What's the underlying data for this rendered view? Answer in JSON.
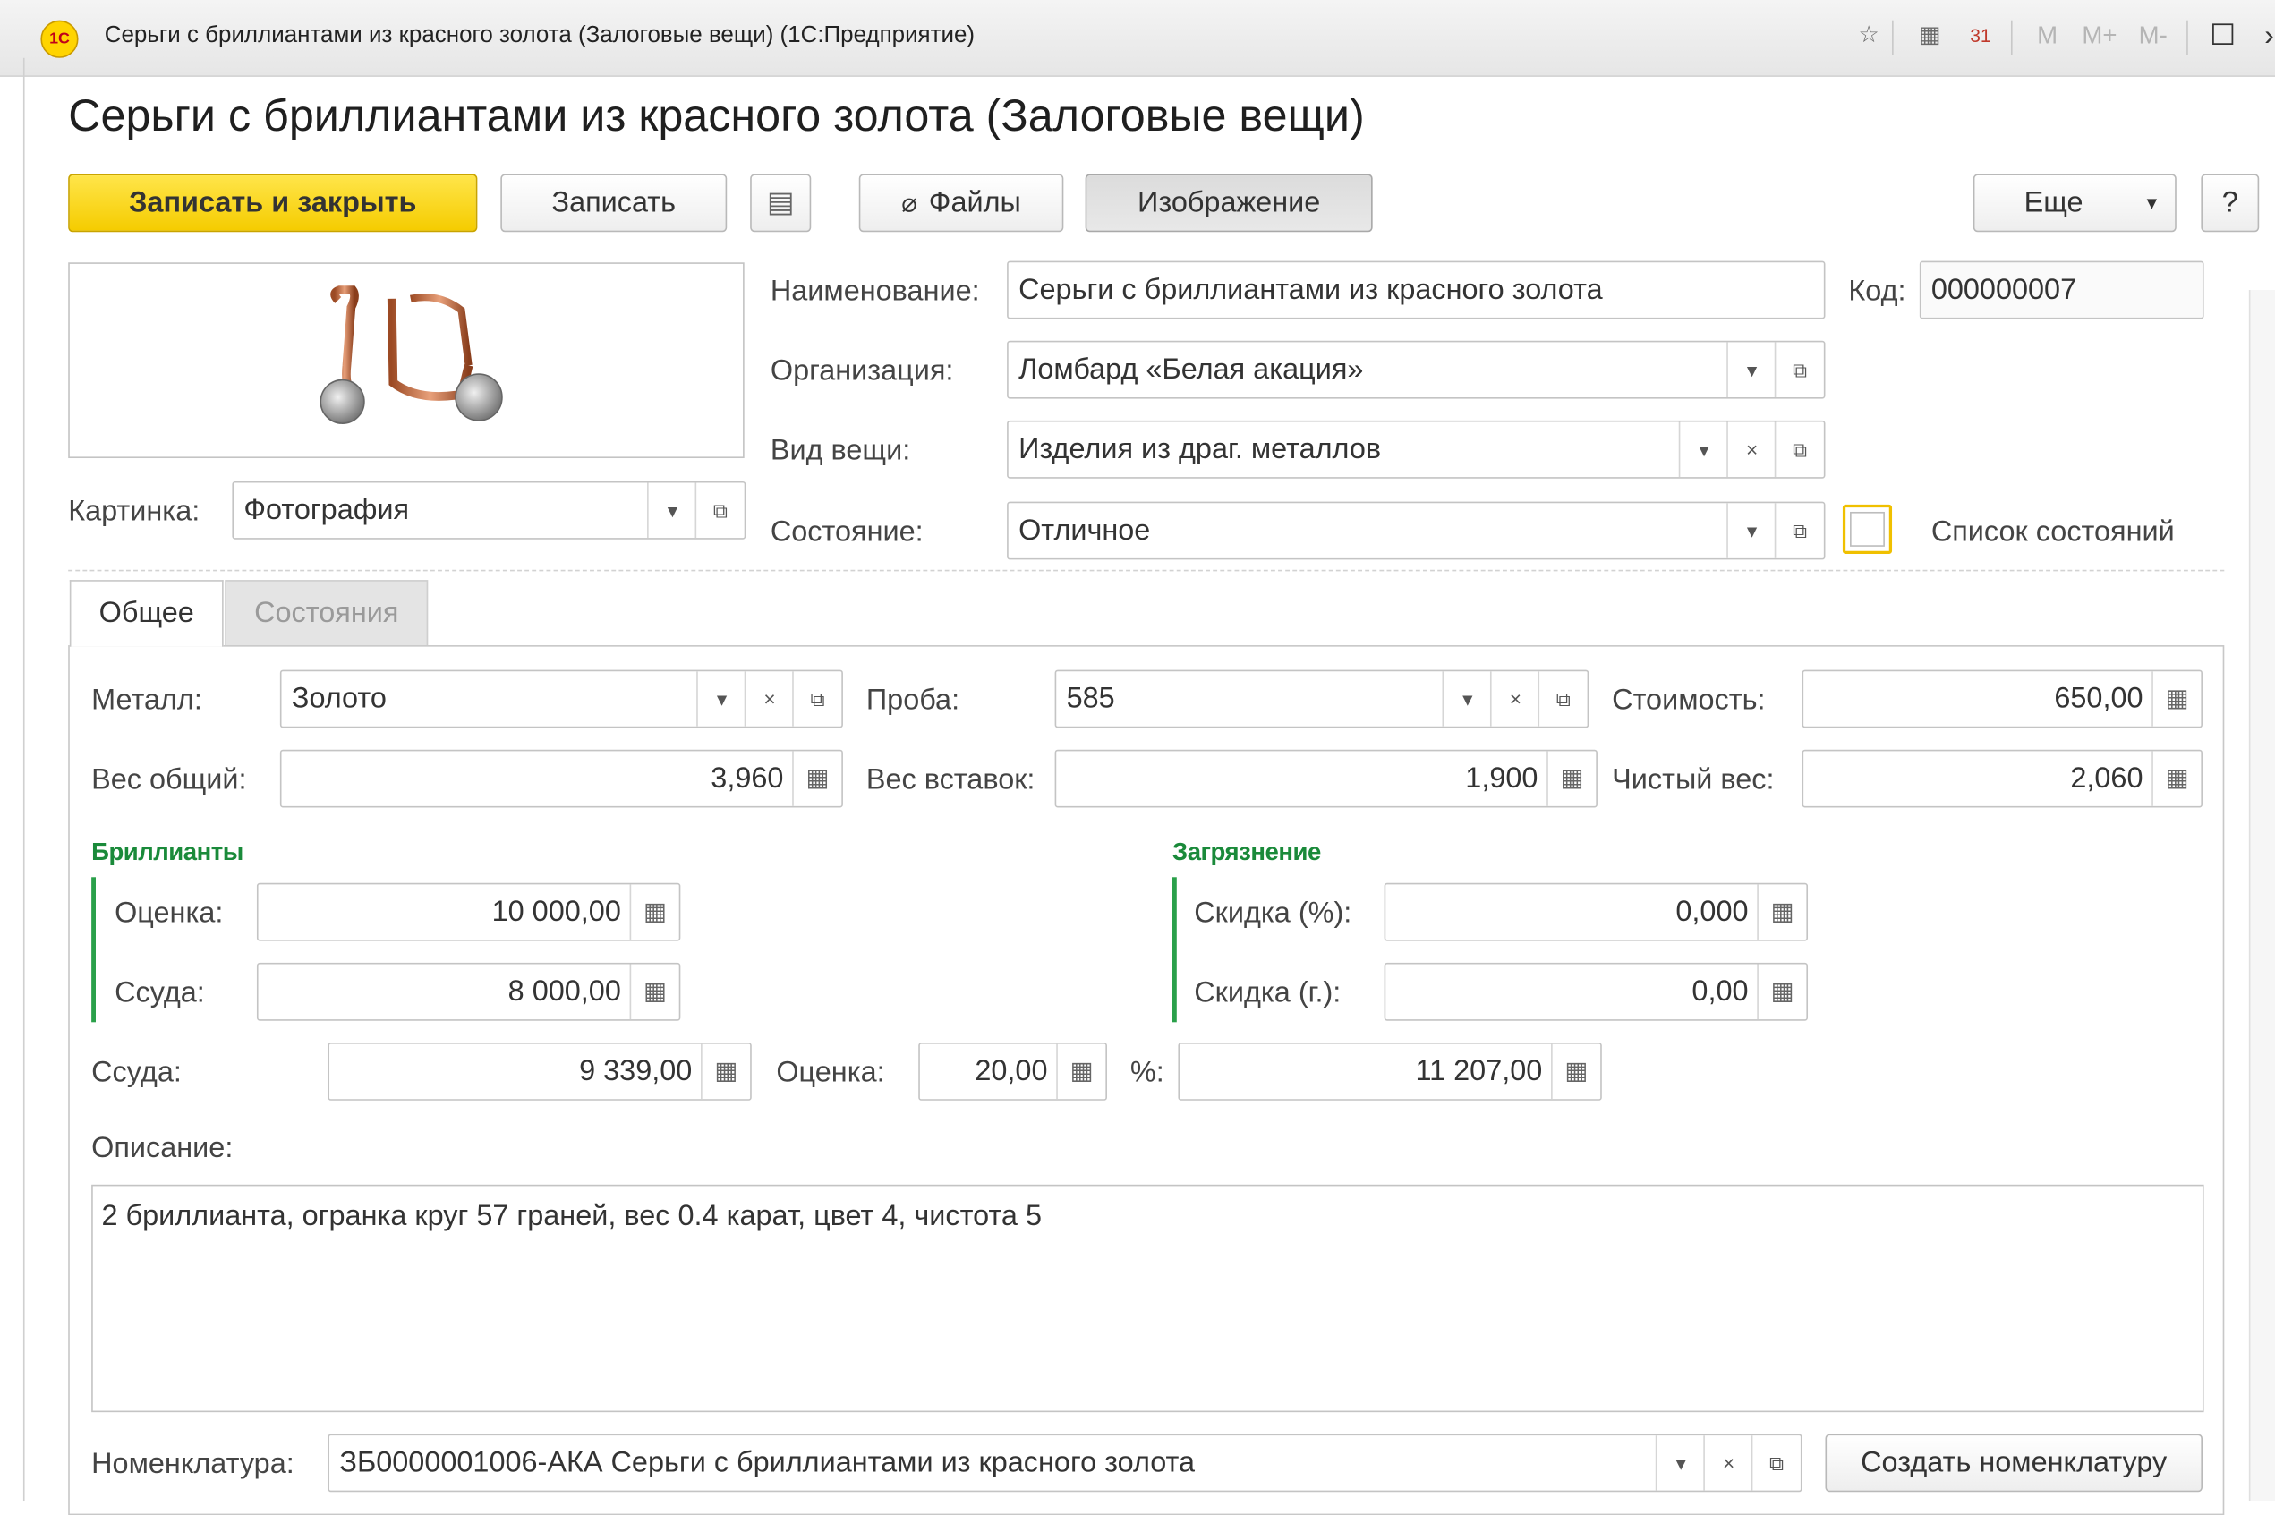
{
  "window": {
    "title": "Серьги с бриллиантами из красного золота (Залоговые вещи)  (1С:Предприятие)",
    "logo_text": "1С",
    "toolbar_icons": [
      "bookmark-star-icon",
      "calculator-icon",
      "calendar-icon"
    ],
    "calendar_day": "31",
    "memory_buttons": [
      "M",
      "M+",
      "M-"
    ],
    "maximize_glyph": "☐",
    "more_glyph": "›"
  },
  "page": {
    "title": "Серьги с бриллиантами из красного золота (Залоговые вещи)"
  },
  "toolbar": {
    "save_close": "Записать и закрыть",
    "save": "Записать",
    "files": "Файлы",
    "image": "Изображение",
    "more": "Еще",
    "help": "?"
  },
  "header": {
    "name_label": "Наименование:",
    "name_value": "Серьги с бриллиантами из красного золота",
    "code_label": "Код:",
    "code_value": "000000007",
    "org_label": "Организация:",
    "org_value": "Ломбард «Белая акация»",
    "kind_label": "Вид вещи:",
    "kind_value": "Изделия из драг. металлов",
    "state_label": "Состояние:",
    "state_value": "Отличное",
    "state_list_label": "Список состояний",
    "state_list_checked": false,
    "picture_label": "Картинка:",
    "picture_value": "Фотография"
  },
  "tabs": [
    {
      "label": "Общее",
      "active": true
    },
    {
      "label": "Состояния",
      "active": false
    }
  ],
  "general": {
    "metal_label": "Металл:",
    "metal_value": "Золото",
    "assay_label": "Проба:",
    "assay_value": "585",
    "cost_label": "Стоимость:",
    "cost_value": "650,00",
    "gross_weight_label": "Вес общий:",
    "gross_weight_value": "3,960",
    "insert_weight_label": "Вес вставок:",
    "insert_weight_value": "1,900",
    "net_weight_label": "Чистый вес:",
    "net_weight_value": "2,060",
    "diamonds": {
      "title": "Бриллианты",
      "estimate_label": "Оценка:",
      "estimate_value": "10 000,00",
      "loan_label": "Ссуда:",
      "loan_value": "8 000,00"
    },
    "contamination": {
      "title": "Загрязнение",
      "discount_pct_label": "Скидка (%):",
      "discount_pct_value": "0,000",
      "discount_g_label": "Скидка (г.):",
      "discount_g_value": "0,00"
    },
    "loan_label": "Ссуда:",
    "loan_value": "9 339,00",
    "estimate_label": "Оценка:",
    "estimate_value": "20,00",
    "percent_label": "%:",
    "percent_value": "11 207,00",
    "description_label": "Описание:",
    "description_value": "2 бриллианта, огранка круг 57 граней, вес 0.4 карат, цвет 4, чистота 5",
    "nomenclature_label": "Номенклатура:",
    "nomenclature_value": "ЗБ0000001006-АКА Серьги с бриллиантами из красного золота",
    "create_nomenclature": "Создать номенклатуру"
  },
  "colors": {
    "primary_button": "#f5cc00",
    "group_title": "#1a8a3a",
    "checkbox_highlight": "#f0c000"
  }
}
